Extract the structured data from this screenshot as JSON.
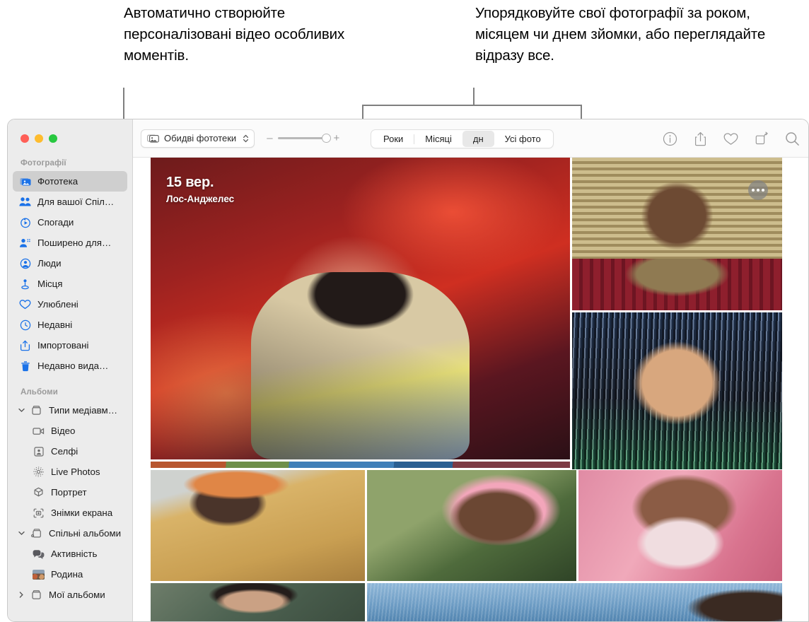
{
  "annotations": {
    "left": "Автоматично створюйте персоналізовані відео особливих моментів.",
    "right": "Упорядковуйте свої фотографії за роком, місяцем чи днем зйомки, або переглядайте відразу все."
  },
  "window": {
    "traffic_lights": [
      "close",
      "minimize",
      "zoom"
    ]
  },
  "toolbar": {
    "library_popup": {
      "label": "Обидві фототеки",
      "icon": "photo-stack-icon",
      "chevron": "chevron-up-down-icon"
    },
    "zoom_slider": {
      "minus": "–",
      "plus": "+",
      "value_percent": 86
    },
    "segments": [
      {
        "label": "Роки",
        "active": false
      },
      {
        "label": "Місяці",
        "active": false
      },
      {
        "label": "дн",
        "active": true
      },
      {
        "label": "Усі фото",
        "active": false
      }
    ],
    "actions": [
      {
        "name": "info-icon",
        "glyph": "info"
      },
      {
        "name": "share-icon",
        "glyph": "share"
      },
      {
        "name": "heart-icon",
        "glyph": "heart"
      },
      {
        "name": "rotate-icon",
        "glyph": "rotate"
      },
      {
        "name": "search-icon",
        "glyph": "search"
      }
    ]
  },
  "sidebar": {
    "sections": [
      {
        "title": "Фотографії",
        "items": [
          {
            "label": "Фототека",
            "icon": "photo-library-icon",
            "selected": true,
            "indent": 0
          },
          {
            "label": "Для вашої Спіл…",
            "icon": "people-two-icon",
            "selected": false,
            "indent": 0
          },
          {
            "label": "Спогади",
            "icon": "memories-play-icon",
            "selected": false,
            "indent": 0
          },
          {
            "label": "Поширено для…",
            "icon": "shared-with-you-icon",
            "selected": false,
            "indent": 0
          },
          {
            "label": "Люди",
            "icon": "person-circle-icon",
            "selected": false,
            "indent": 0
          },
          {
            "label": "Місця",
            "icon": "map-pin-icon",
            "selected": false,
            "indent": 0
          },
          {
            "label": "Улюблені",
            "icon": "heart-icon",
            "selected": false,
            "indent": 0
          },
          {
            "label": "Недавні",
            "icon": "clock-icon",
            "selected": false,
            "indent": 0
          },
          {
            "label": "Імпортовані",
            "icon": "import-icon",
            "selected": false,
            "indent": 0
          },
          {
            "label": "Недавно вида…",
            "icon": "trash-icon",
            "selected": false,
            "indent": 0
          }
        ]
      },
      {
        "title": "Альбоми",
        "items": [
          {
            "label": "Типи медіавм…",
            "icon": "album-icon",
            "selected": false,
            "indent": 0,
            "twisty": "down"
          },
          {
            "label": "Відео",
            "icon": "video-icon",
            "selected": false,
            "indent": 1
          },
          {
            "label": "Селфі",
            "icon": "selfie-icon",
            "selected": false,
            "indent": 1
          },
          {
            "label": "Live Photos",
            "icon": "live-photos-icon",
            "selected": false,
            "indent": 1
          },
          {
            "label": "Портрет",
            "icon": "portrait-cube-icon",
            "selected": false,
            "indent": 1
          },
          {
            "label": "Знімки екрана",
            "icon": "screenshot-icon",
            "selected": false,
            "indent": 1
          },
          {
            "label": "Спільні альбоми",
            "icon": "shared-album-icon",
            "selected": false,
            "indent": 0,
            "twisty": "down"
          },
          {
            "label": "Активність",
            "icon": "activity-bubbles-icon",
            "selected": false,
            "indent": 1
          },
          {
            "label": "Родина",
            "icon": "album-thumbnail",
            "selected": false,
            "indent": 1
          },
          {
            "label": "Мої альбоми",
            "icon": "album-icon",
            "selected": false,
            "indent": 0,
            "twisty": "right"
          }
        ]
      }
    ]
  },
  "grid": {
    "date_overlay": {
      "date": "15 вер.",
      "place": "Лос-Анджелес"
    },
    "more_button": "more-options-button",
    "photos": [
      {
        "name": "photo-main-portrait-red"
      },
      {
        "name": "photo-blinds-diner"
      },
      {
        "name": "photo-drip-texture"
      },
      {
        "name": "photo-beaded-headdress"
      },
      {
        "name": "photo-pink-afro"
      },
      {
        "name": "photo-pink-bubblegum"
      },
      {
        "name": "photo-laughing-woman"
      },
      {
        "name": "photo-ocean-swimmer"
      }
    ]
  }
}
